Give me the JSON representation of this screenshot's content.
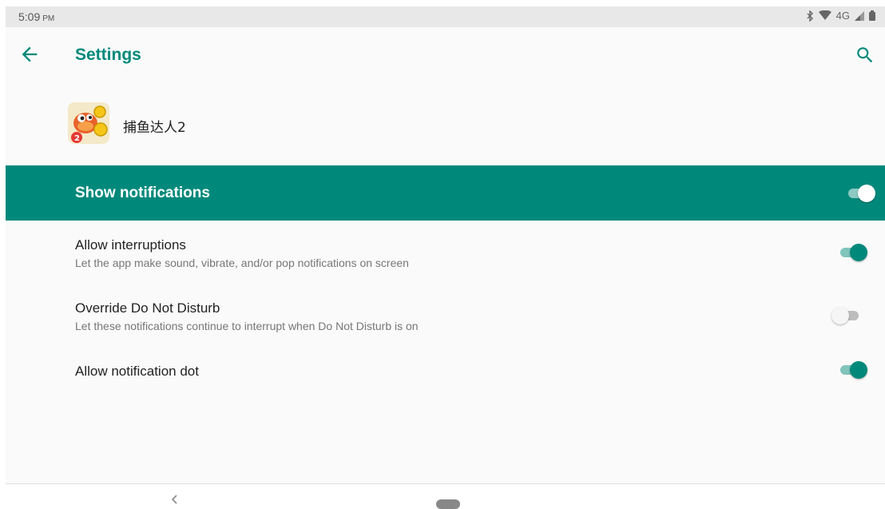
{
  "status_bar": {
    "time": "5:09",
    "ampm": "PM",
    "network": "4G"
  },
  "app_bar": {
    "title": "Settings"
  },
  "app": {
    "name": "捕鱼达人2"
  },
  "master": {
    "label": "Show notifications",
    "enabled": true
  },
  "settings": [
    {
      "title": "Allow interruptions",
      "summary": "Let the app make sound, vibrate, and/or pop notifications on screen",
      "enabled": true
    },
    {
      "title": "Override Do Not Disturb",
      "summary": "Let these notifications continue to interrupt when Do Not Disturb is on",
      "enabled": false
    },
    {
      "title": "Allow notification dot",
      "summary": "",
      "enabled": true
    }
  ],
  "colors": {
    "accent": "#00897b",
    "accent_light": "#80c4bc",
    "background": "#fafafa",
    "status_bar": "#e8e8e8"
  },
  "icons": {
    "back": "arrow-left-icon",
    "search": "search-icon",
    "bluetooth": "bluetooth-icon",
    "wifi": "wifi-icon",
    "signal": "signal-icon",
    "battery": "battery-icon"
  }
}
